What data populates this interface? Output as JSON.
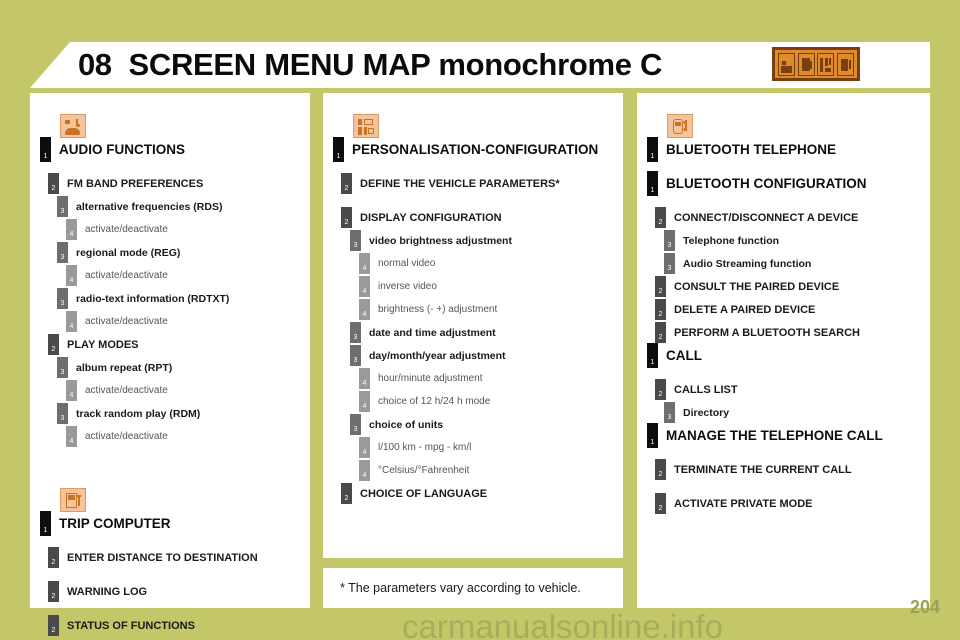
{
  "header": {
    "chapter_number": "08",
    "title": "SCREEN MENU MAP monochrome C",
    "icon_strip_name": "chapter-icon-strip"
  },
  "columns": [
    {
      "id": "column-audio-trip",
      "sections": [
        {
          "icon": "audio-speaker-icon",
          "rows": [
            {
              "level": 1,
              "text": "AUDIO FUNCTIONS"
            },
            {
              "level": 2,
              "text": "FM BAND PREFERENCES"
            },
            {
              "level": 3,
              "text": "alternative frequencies (RDS)"
            },
            {
              "level": 4,
              "text": "activate/deactivate"
            },
            {
              "level": 3,
              "text": "regional mode (REG)"
            },
            {
              "level": 4,
              "text": "activate/deactivate"
            },
            {
              "level": 3,
              "text": "radio-text information (RDTXT)"
            },
            {
              "level": 4,
              "text": "activate/deactivate"
            },
            {
              "level": 2,
              "text": "PLAY MODES"
            },
            {
              "level": 3,
              "text": "album repeat (RPT)"
            },
            {
              "level": 4,
              "text": "activate/deactivate"
            },
            {
              "level": 3,
              "text": "track random play (RDM)"
            },
            {
              "level": 4,
              "text": "activate/deactivate"
            }
          ]
        },
        {
          "icon": "fuel-pump-icon",
          "rows": [
            {
              "level": 1,
              "text": "TRIP COMPUTER"
            },
            {
              "level": 2,
              "text": "ENTER DISTANCE TO DESTINATION"
            },
            {
              "level": 2,
              "text": "WARNING LOG"
            },
            {
              "level": 2,
              "text": "STATUS OF FUNCTIONS"
            }
          ]
        }
      ]
    },
    {
      "id": "column-personalisation",
      "sections": [
        {
          "icon": "settings-panel-icon",
          "rows": [
            {
              "level": 1,
              "text": "PERSONALISATION-CONFIGURATION"
            },
            {
              "level": 2,
              "text": "DEFINE THE VEHICLE PARAMETERS*"
            },
            {
              "level": 2,
              "text": "DISPLAY CONFIGURATION"
            },
            {
              "level": 3,
              "text": "video brightness adjustment"
            },
            {
              "level": 4,
              "text": "normal video"
            },
            {
              "level": 4,
              "text": "inverse video"
            },
            {
              "level": 4,
              "text": "brightness (- +) adjustment"
            },
            {
              "level": 3,
              "text": "date and time adjustment"
            },
            {
              "level": 3,
              "text": "day/month/year adjustment"
            },
            {
              "level": 4,
              "text": "hour/minute adjustment"
            },
            {
              "level": 4,
              "text": "choice of 12 h/24 h mode"
            },
            {
              "level": 3,
              "text": "choice of units"
            },
            {
              "level": 4,
              "text": "l/100 km - mpg - km/l"
            },
            {
              "level": 4,
              "text": "°Celsius/°Fahrenheit"
            },
            {
              "level": 2,
              "text": "CHOICE OF LANGUAGE"
            }
          ]
        }
      ]
    },
    {
      "id": "column-bluetooth",
      "sections": [
        {
          "icon": "bluetooth-phone-icon",
          "rows": [
            {
              "level": 1,
              "text": "BLUETOOTH TELEPHONE"
            },
            {
              "level": 1,
              "text": "BLUETOOTH CONFIGURATION"
            },
            {
              "level": 2,
              "text": "CONNECT/DISCONNECT A DEVICE"
            },
            {
              "level": 3,
              "text": "Telephone function"
            },
            {
              "level": 3,
              "text": "Audio Streaming function"
            },
            {
              "level": 2,
              "text": "CONSULT THE PAIRED DEVICE"
            },
            {
              "level": 2,
              "text": "DELETE A PAIRED DEVICE"
            },
            {
              "level": 2,
              "text": "PERFORM A BLUETOOTH SEARCH"
            },
            {
              "level": 1,
              "text": "CALL"
            },
            {
              "level": 2,
              "text": "CALLS LIST"
            },
            {
              "level": 3,
              "text": "Directory"
            },
            {
              "level": 1,
              "text": "MANAGE THE TELEPHONE CALL"
            },
            {
              "level": 2,
              "text": "TERMINATE THE CURRENT CALL"
            },
            {
              "level": 2,
              "text": "ACTIVATE PRIVATE MODE"
            }
          ]
        }
      ]
    }
  ],
  "footnote": "* The parameters vary according to vehicle.",
  "page_number": "204",
  "watermark": "carmanualsonline.info",
  "colors": {
    "background": "#c3c768",
    "panel": "#ffffff",
    "icon_fill": "#f6c49a",
    "icon_stroke": "#c8732a",
    "level1": "#0d0d0d",
    "level2": "#4a4a4a",
    "level3": "#6e6e6e",
    "level4": "#9a9a9a"
  },
  "markers": {
    "1": "1",
    "2": "2",
    "3": "3",
    "4": "4"
  }
}
